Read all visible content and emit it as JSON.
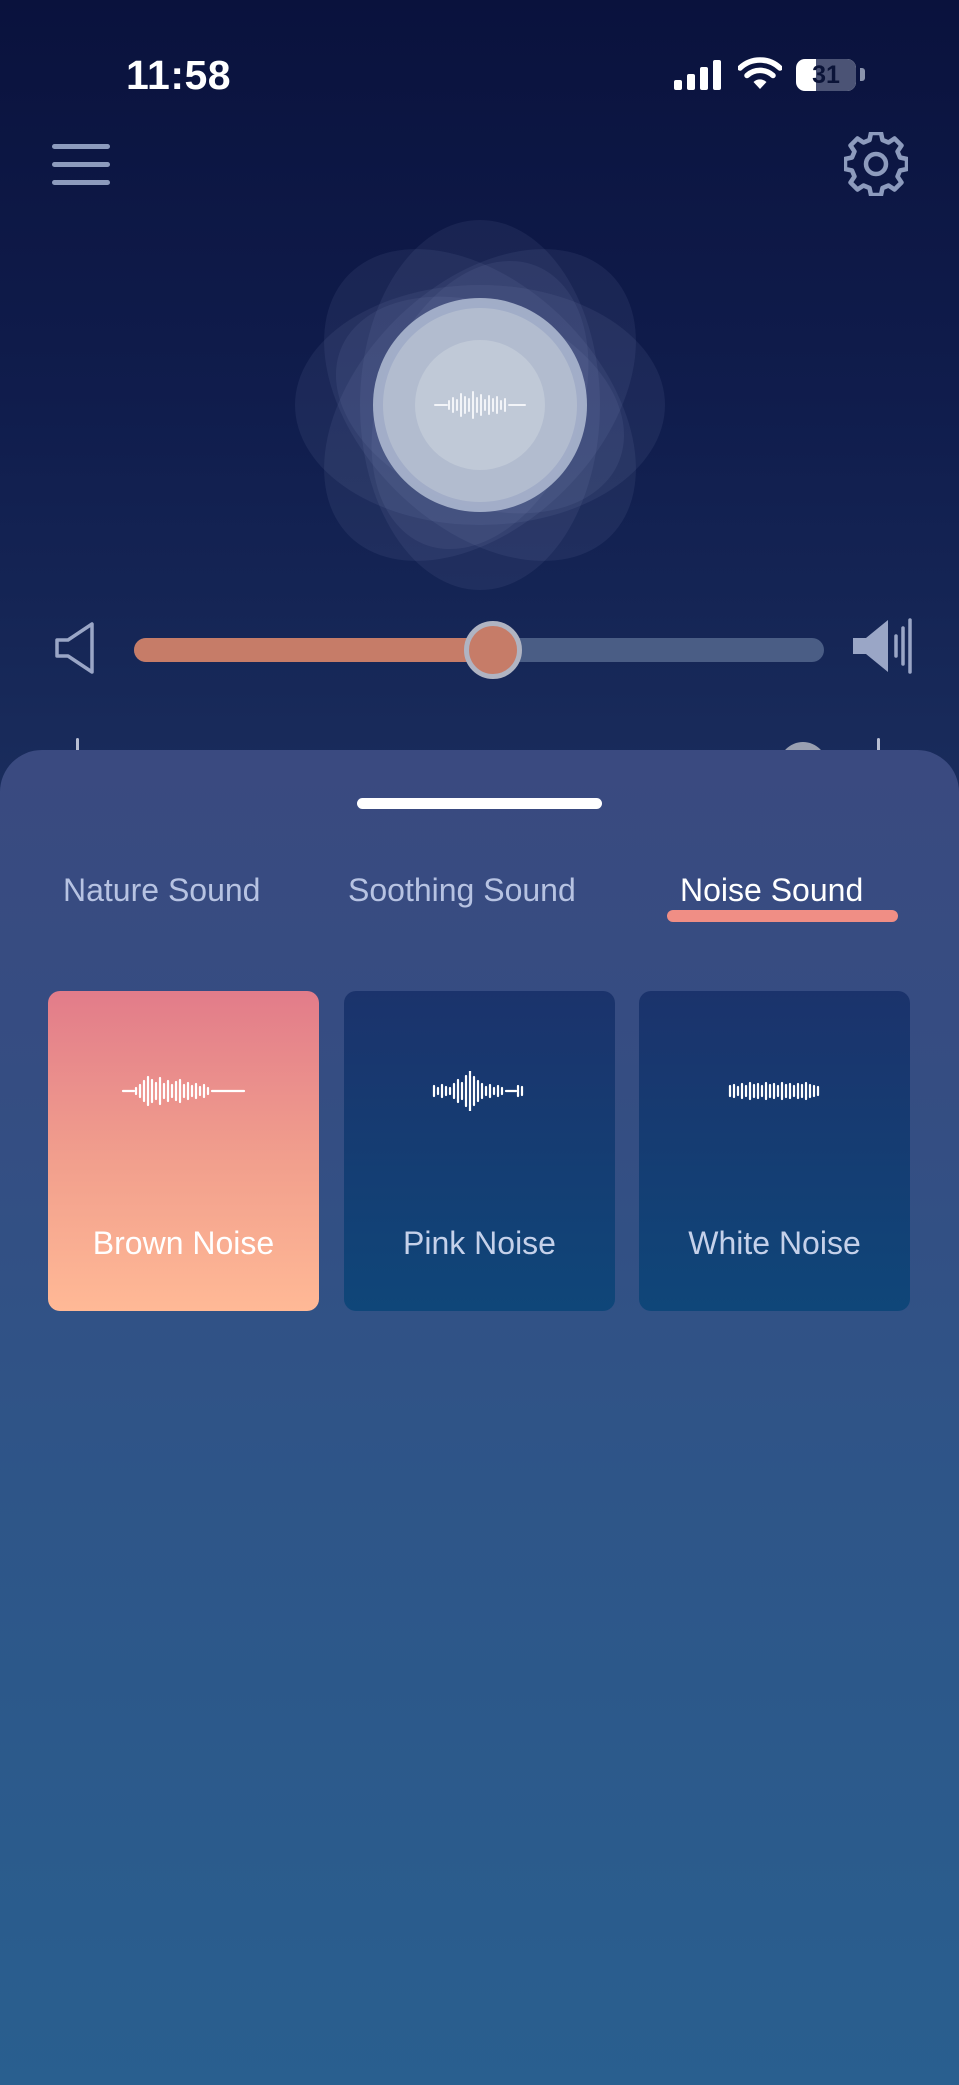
{
  "status_bar": {
    "time": "11:58",
    "battery": "31"
  },
  "header": {
    "menu_icon": "hamburger-menu-icon",
    "settings_icon": "gear-icon"
  },
  "player": {
    "visual_icon": "sound-wave-icon"
  },
  "volume": {
    "low_icon": "volume-low-icon",
    "high_icon": "volume-high-icon",
    "level_fraction": 0.52
  },
  "tabs": [
    {
      "label": "Nature Sound",
      "selected": false
    },
    {
      "label": "Soothing Sound",
      "selected": false
    },
    {
      "label": "Noise Sound",
      "selected": true
    }
  ],
  "sounds": [
    {
      "label": "Brown Noise",
      "selected": true
    },
    {
      "label": "Pink Noise",
      "selected": false
    },
    {
      "label": "White Noise",
      "selected": false
    }
  ],
  "colors": {
    "accent": "#f08e85",
    "slider_fill": "#c67c68",
    "card_selected_top": "#e27c8a",
    "card_selected_bottom": "#ffb996",
    "card_default": "#17386f"
  }
}
